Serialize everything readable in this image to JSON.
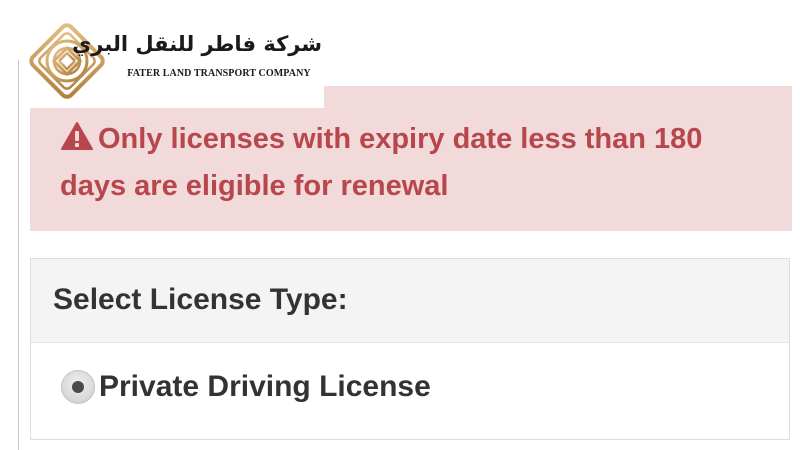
{
  "logo": {
    "arabic_name": "شركة فاطر للنقل البري",
    "english_name": "FATER LAND TRANSPORT COMPANY",
    "mark_color": "#c89a58"
  },
  "alert": {
    "icon": "warning-triangle-icon",
    "message": "Only licenses with expiry date less than 180 days are eligible for renewal",
    "background": "#f2d9da",
    "text_color": "#b7464d"
  },
  "license_type": {
    "heading": "Select License Type:",
    "options": [
      {
        "label": "Private Driving License",
        "selected": true
      }
    ]
  }
}
